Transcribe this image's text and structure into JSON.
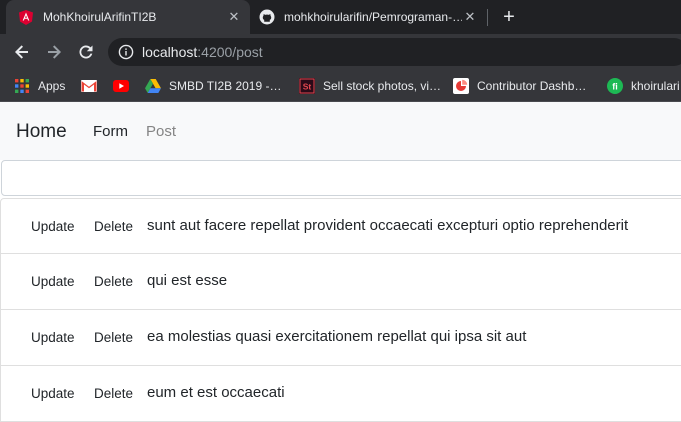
{
  "browser": {
    "tabs": [
      {
        "title": "MohKhoirulArifinTI2B",
        "favicon": "angular-icon",
        "active": true
      },
      {
        "title": "mohkhoirularifin/Pemrograman-…",
        "favicon": "github-icon",
        "active": false
      }
    ],
    "new_tab": "+",
    "close_glyph": "✕",
    "url_host": "localhost",
    "url_rest": ":4200/post",
    "bookmarks": [
      {
        "label": "Apps",
        "icon": "apps-grid-icon"
      },
      {
        "label": "",
        "icon": "gmail-icon"
      },
      {
        "label": "",
        "icon": "youtube-icon"
      },
      {
        "label": "SMBD TI2B 2019 -…",
        "icon": "google-drive-icon"
      },
      {
        "label": "Sell stock photos, vi…",
        "icon": "adobe-stock-icon"
      },
      {
        "label": "Contributor Dashb…",
        "icon": "contributor-icon"
      },
      {
        "label": "khoirulari",
        "icon": "fi-icon"
      }
    ]
  },
  "page": {
    "brand": "Home",
    "nav": {
      "form": "Form",
      "post": "Post"
    },
    "search": {
      "value": "",
      "placeholder": ""
    },
    "update_label": "Update",
    "delete_label": "Delete",
    "posts": [
      "sunt aut facere repellat provident occaecati excepturi optio reprehenderit",
      "qui est esse",
      "ea molestias quasi exercitationem repellat qui ipsa sit aut",
      "eum et est occaecati"
    ]
  },
  "colors": {
    "tab_bg": "#202124",
    "toolbar_bg": "#35363a",
    "navbar_bg": "#f8f9fa",
    "angular_red": "#dd0031"
  }
}
